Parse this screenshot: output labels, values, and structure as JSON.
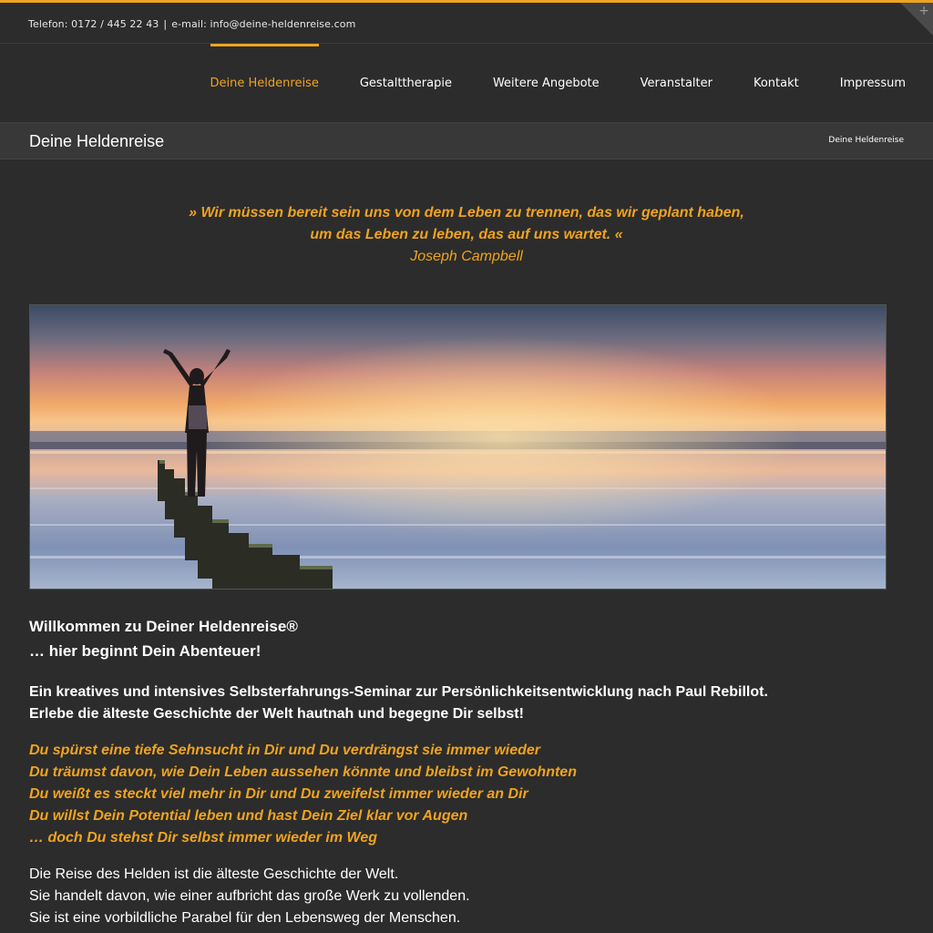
{
  "topbar": {
    "phone": "Telefon: 0172 / 445 22 43",
    "separator": "|",
    "email": "e-mail: info@deine-heldenreise.com",
    "corner_icon": "plus-icon"
  },
  "nav": {
    "items": [
      {
        "label": "Deine Heldenreise",
        "active": true
      },
      {
        "label": "Gestalttherapie",
        "active": false
      },
      {
        "label": "Weitere Angebote",
        "active": false
      },
      {
        "label": "Veranstalter",
        "active": false
      },
      {
        "label": "Kontakt",
        "active": false
      },
      {
        "label": "Impressum",
        "active": false
      }
    ]
  },
  "titlebar": {
    "title": "Deine Heldenreise",
    "breadcrumb": "Deine Heldenreise"
  },
  "quote": {
    "line1": "» Wir müssen bereit sein uns von dem Leben zu trennen, das wir geplant haben,",
    "line2": "um das Leben zu leben, das auf uns wartet. «",
    "author": "Joseph Campbell"
  },
  "content": {
    "welcome": [
      "Willkommen zu Deiner Heldenreise®",
      "… hier beginnt Dein Abenteuer!"
    ],
    "intro": [
      "Ein kreatives und intensives Selbsterfahrungs-Seminar zur Persönlichkeitsentwicklung nach Paul Rebillot.",
      "Erlebe die älteste Geschichte der Welt hautnah und begegne Dir selbst!"
    ],
    "italic": [
      "Du spürst eine tiefe Sehnsucht in Dir und Du verdrängst sie immer wieder",
      "Du träumst davon, wie Dein Leben aussehen könnte und bleibst im Gewohnten",
      "Du weißt es steckt viel mehr in Dir und Du zweifelst immer wieder an Dir",
      "Du willst Dein Potential leben und hast Dein Ziel klar vor Augen",
      "… doch Du stehst Dir selbst immer wieder im Weg"
    ],
    "story": [
      "Die Reise des Helden ist die älteste Geschichte der Welt.",
      "Sie handelt davon, wie einer aufbricht das große Werk zu vollenden.",
      "Sie ist eine vorbildliche Parabel für den Lebensweg der Menschen."
    ]
  },
  "colors": {
    "accent": "#f0a31f",
    "background": "#2c2c2c",
    "titlebar": "#383838"
  }
}
